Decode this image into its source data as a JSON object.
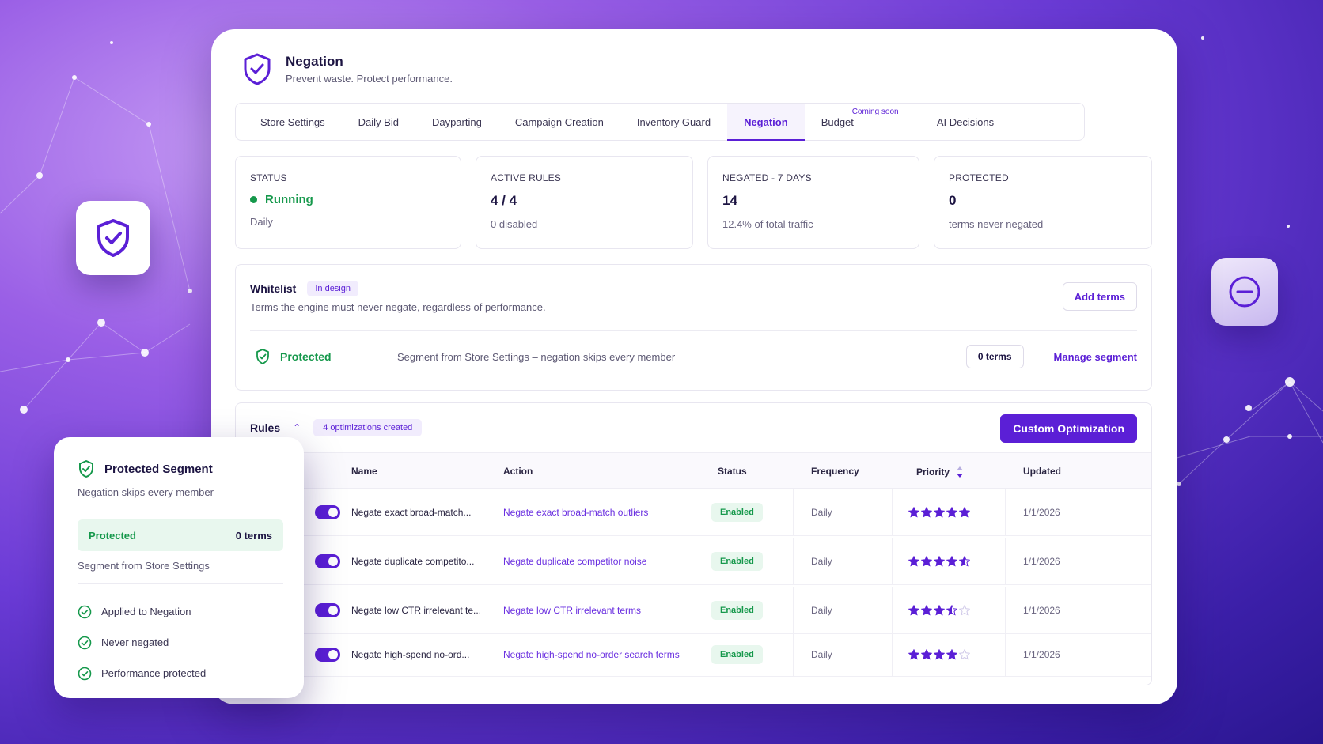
{
  "header": {
    "title": "Negation",
    "subtitle": "Prevent waste. Protect performance."
  },
  "tabs": [
    {
      "label": "Store Settings",
      "active": false
    },
    {
      "label": "Daily Bid",
      "active": false
    },
    {
      "label": "Dayparting",
      "active": false
    },
    {
      "label": "Campaign Creation",
      "active": false
    },
    {
      "label": "Inventory Guard",
      "active": false
    },
    {
      "label": "Negation",
      "active": true
    },
    {
      "label": "Budget",
      "active": false,
      "badge": "Coming soon"
    },
    {
      "label": "AI Decisions",
      "active": false
    }
  ],
  "stats": [
    {
      "label": "Status",
      "value": "Running",
      "sub": "Daily"
    },
    {
      "label": "Active Rules",
      "value": "4 / 4",
      "sub": "0 disabled"
    },
    {
      "label": "Negated - 7 Days",
      "value": "14",
      "sub": "12.4% of total traffic"
    },
    {
      "label": "Protected",
      "value": "0",
      "sub": "terms never negated"
    }
  ],
  "whitelist": {
    "title": "Whitelist",
    "badge": "In design",
    "description": "Terms the engine must never negate, regardless of performance.",
    "add_button": "Add terms",
    "segment": {
      "status": "Protected",
      "text": "Segment from Store Settings – negation skips every member",
      "terms": "0 terms",
      "manage_link": "Manage segment"
    }
  },
  "rules": {
    "title": "Rules",
    "badge": "4 optimizations created",
    "custom_button": "Custom Optimization",
    "columns": {
      "name": "Name",
      "action": "Action",
      "status": "Status",
      "frequency": "Frequency",
      "priority": "Priority",
      "updated": "Updated"
    },
    "rows": [
      {
        "enabled": true,
        "name": "Negate exact broad-match...",
        "action": "Negate exact broad-match outliers",
        "status": "Enabled",
        "frequency": "Daily",
        "priority": 5,
        "updated": "1/1/2026"
      },
      {
        "enabled": true,
        "name": "Negate duplicate competito...",
        "action": "Negate duplicate competitor noise",
        "status": "Enabled",
        "frequency": "Daily",
        "priority": 4.5,
        "updated": "1/1/2026"
      },
      {
        "enabled": true,
        "name": "Negate low CTR irrelevant te...",
        "action": "Negate low CTR irrelevant terms",
        "status": "Enabled",
        "frequency": "Daily",
        "priority": 3.5,
        "updated": "1/1/2026"
      },
      {
        "enabled": true,
        "name": "Negate high-spend no-ord...",
        "action": "Negate high-spend no-order search terms",
        "status": "Enabled",
        "frequency": "Daily",
        "priority": 4,
        "updated": "1/1/2026"
      }
    ]
  },
  "side_card": {
    "title": "Protected Segment",
    "subtitle": "Negation skips every member",
    "pill_status": "Protected",
    "pill_terms": "0 terms",
    "segment_text": "Segment from Store Settings",
    "checks": [
      "Applied to Negation",
      "Never negated",
      "Performance protected"
    ]
  },
  "colors": {
    "accent": "#5b1fd6",
    "success": "#15984b",
    "success_bg": "#e8f7ee"
  },
  "icons": {
    "header": "shield-check-icon",
    "float_left": "shield-check-icon",
    "float_right": "minus-circle-icon"
  }
}
